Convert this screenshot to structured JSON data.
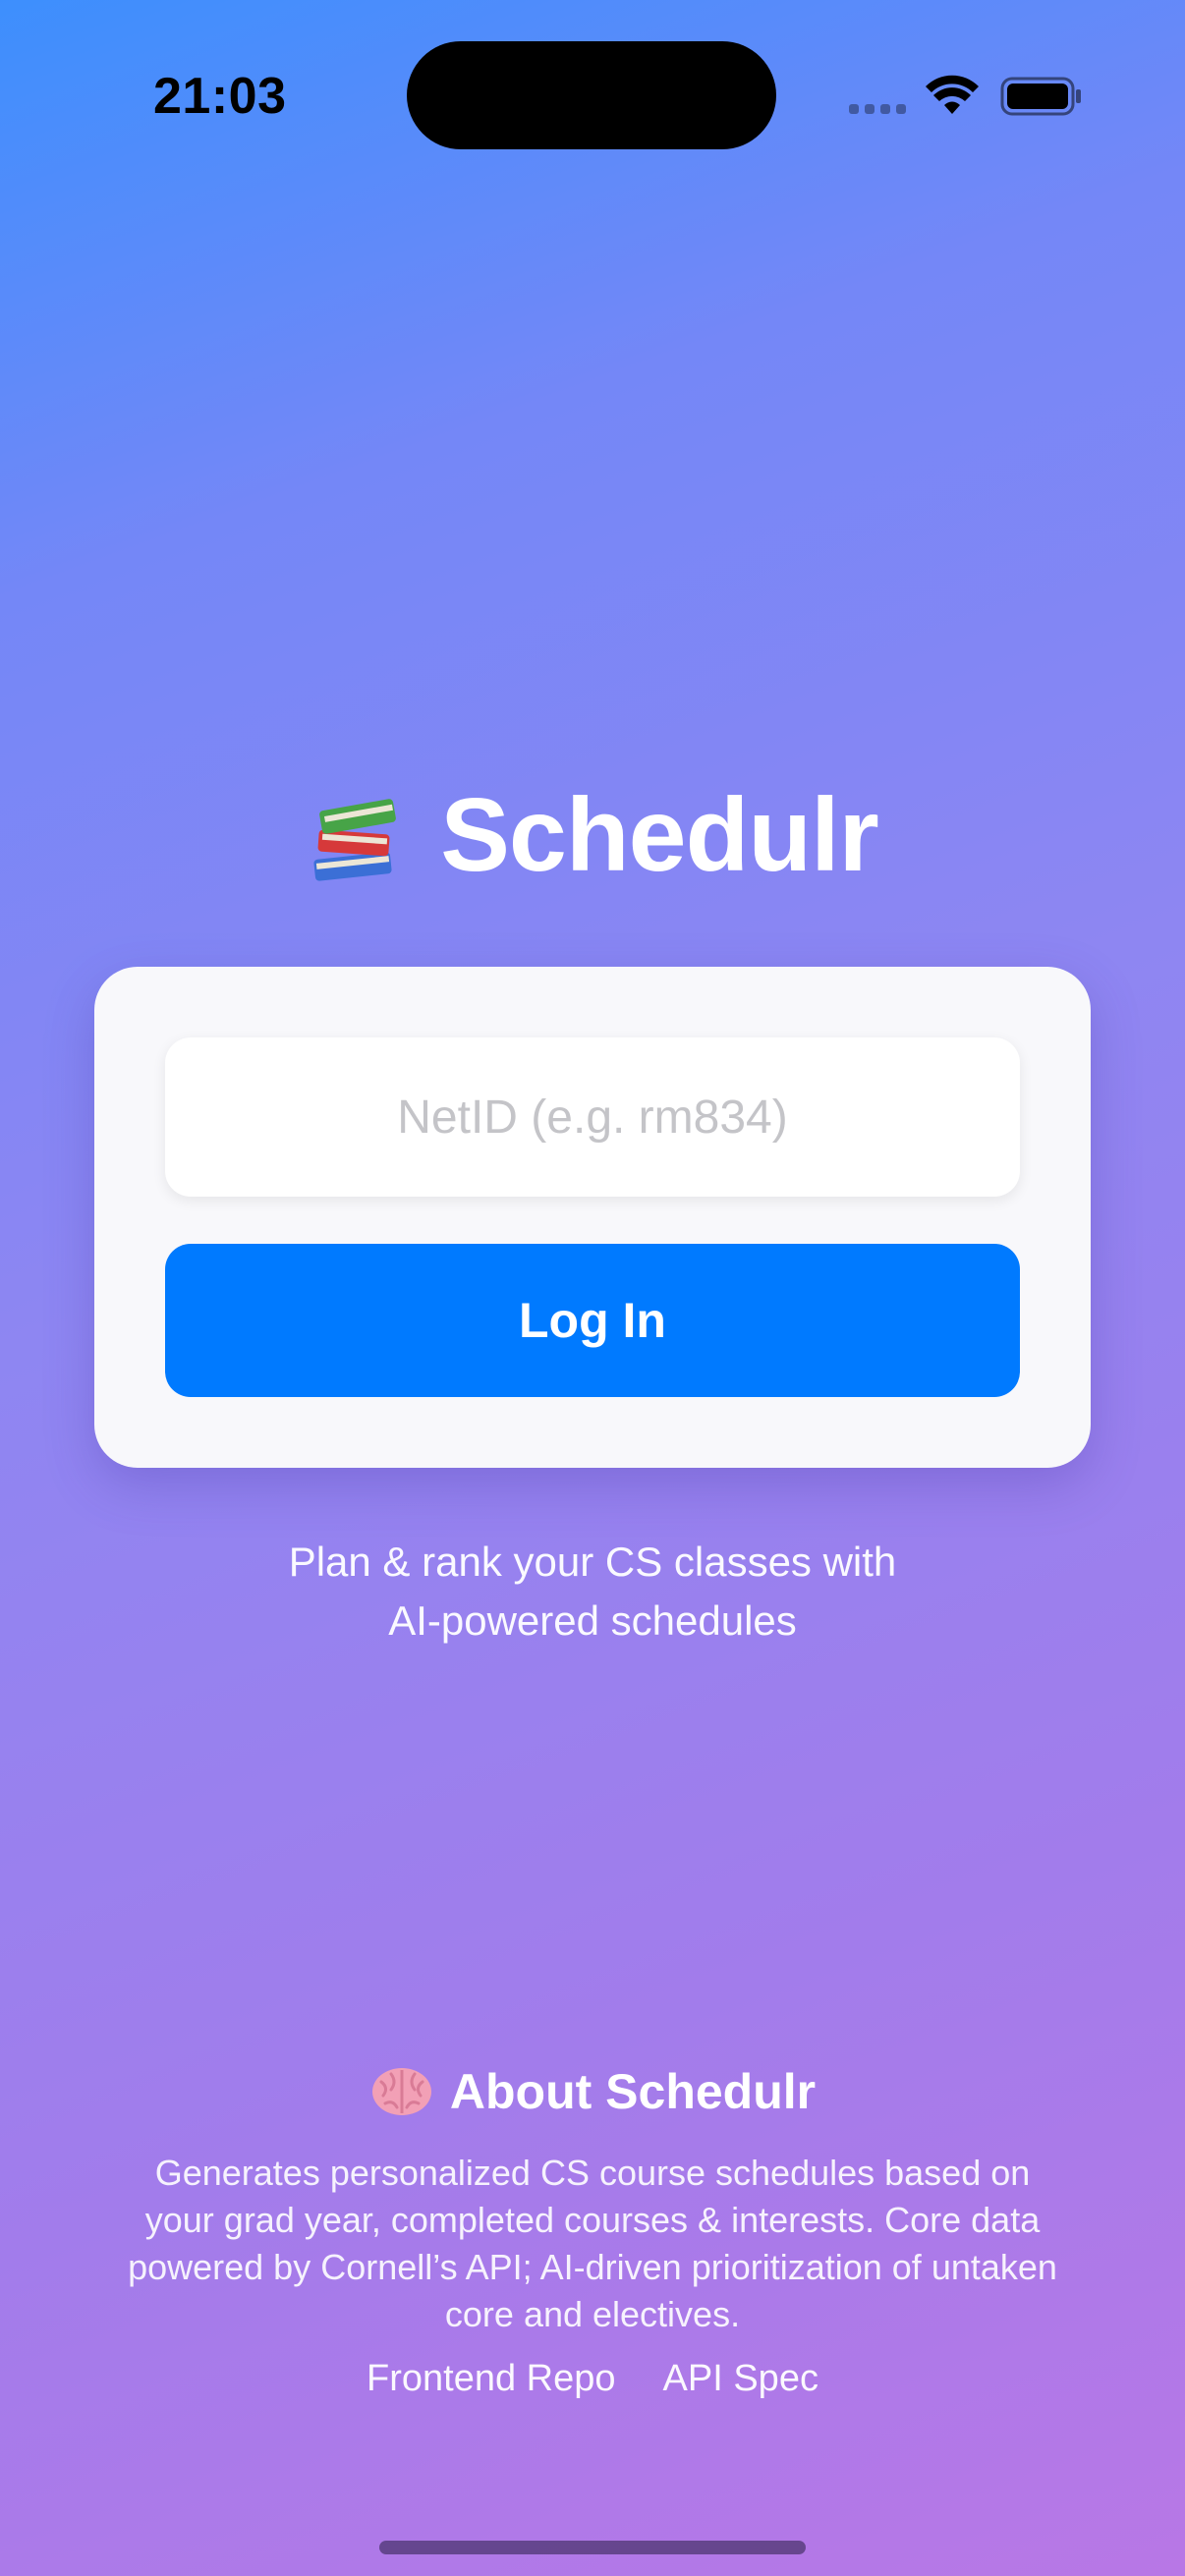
{
  "status_bar": {
    "time": "21:03",
    "icons": [
      "cellular-icon",
      "wifi-icon",
      "battery-icon"
    ]
  },
  "header": {
    "icon": "books-icon",
    "title": "Schedulr"
  },
  "login": {
    "netid_placeholder": "NetID (e.g. rm834)",
    "netid_value": "",
    "button_label": "Log In"
  },
  "tagline": {
    "lines": [
      "Plan & rank your CS classes with",
      "AI-powered schedules"
    ]
  },
  "about": {
    "icon": "brain-icon",
    "title": "About Schedulr",
    "lines": [
      "Generates personalized CS course schedules based on",
      "your grad year, completed courses & interests. Core data",
      "powered by Cornell’s API; AI-driven prioritization of untaken",
      "core and electives."
    ],
    "links": [
      "Frontend Repo",
      "API Spec"
    ]
  },
  "colors": {
    "accent": "#007aff",
    "gradient_top": "#3d8ffd",
    "gradient_bottom": "#b877e6",
    "card": "#f8f8fb"
  }
}
